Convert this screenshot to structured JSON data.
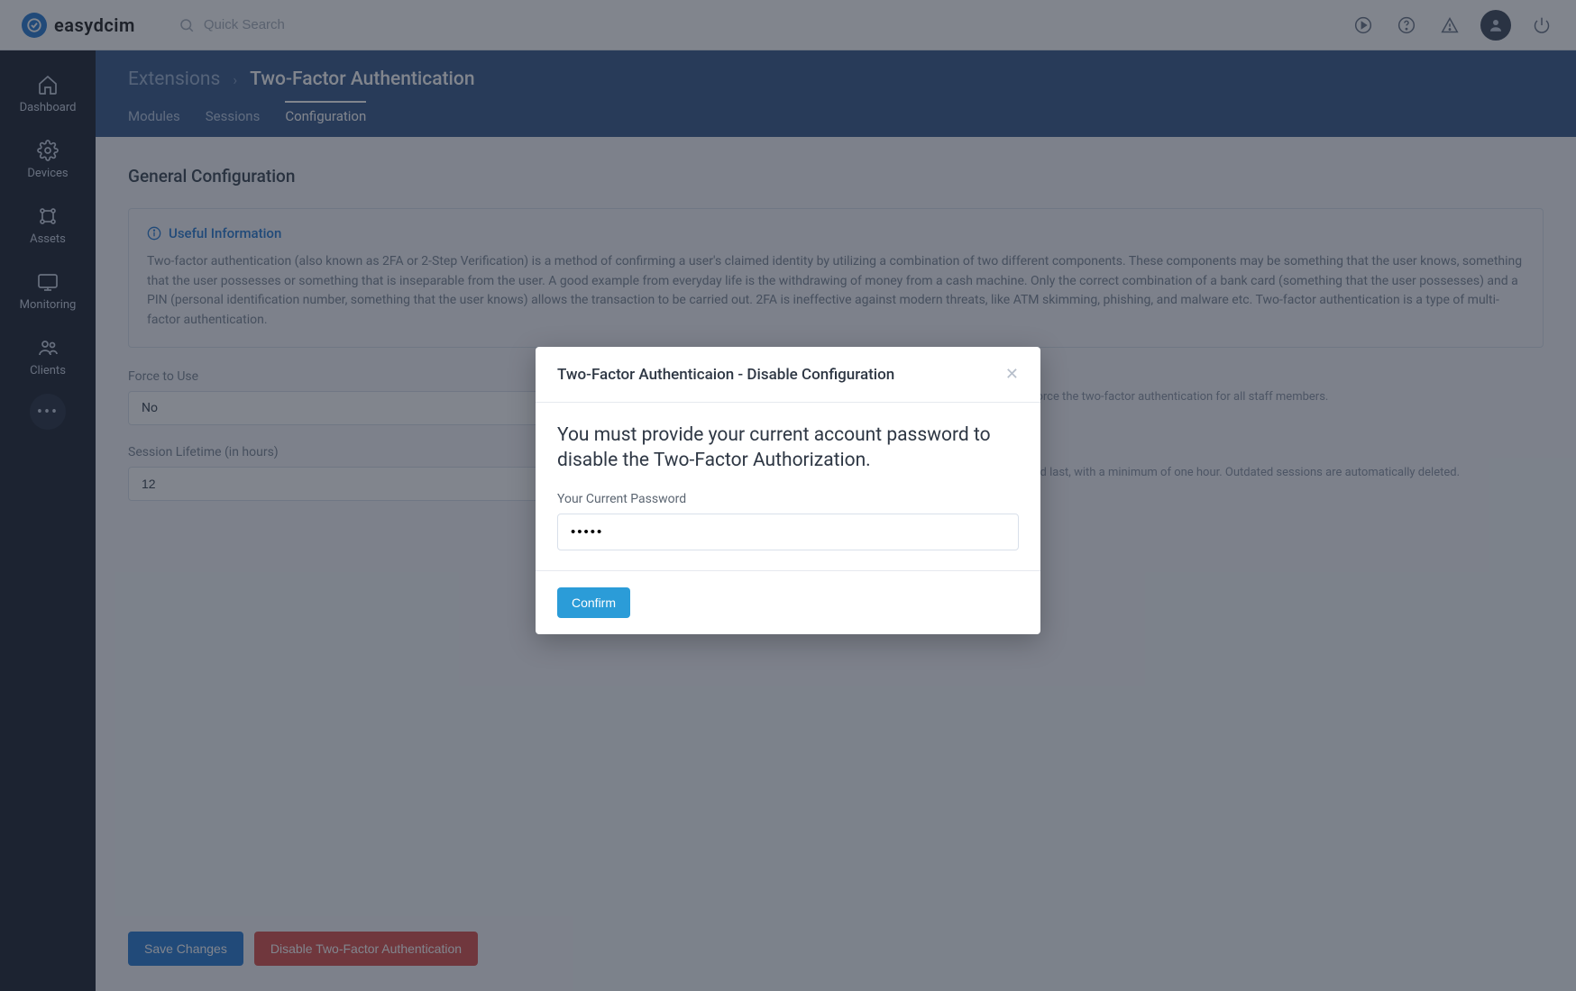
{
  "brand": {
    "name": "easydcim"
  },
  "search": {
    "placeholder": "Quick Search"
  },
  "sidebar": {
    "items": [
      {
        "label": "Dashboard"
      },
      {
        "label": "Devices"
      },
      {
        "label": "Assets"
      },
      {
        "label": "Monitoring"
      },
      {
        "label": "Clients"
      }
    ]
  },
  "breadcrumb": {
    "parent": "Extensions",
    "current": "Two-Factor Authentication"
  },
  "tabs": [
    {
      "label": "Modules",
      "active": false
    },
    {
      "label": "Sessions",
      "active": false
    },
    {
      "label": "Configuration",
      "active": true
    }
  ],
  "section": {
    "title": "General Configuration",
    "info_title": "Useful Information",
    "info_body": "Two-factor authentication (also known as 2FA or 2-Step Verification) is a method of confirming a user's claimed identity by utilizing a combination of two different components. These components may be something that the user knows, something that the user possesses or something that is inseparable from the user. A good example from everyday life is the withdrawing of money from a cash machine. Only the correct combination of a bank card (something that the user possesses) and a PIN (personal identification number, something that the user knows) allows the transaction to be carried out. 2FA is ineffective against modern threats, like ATM skimming, phishing, and malware etc. Two-factor authentication is a type of multi-factor authentication."
  },
  "form": {
    "force_label": "Force to Use",
    "force_value": "No",
    "force_help": "By selecting this option you will enforce the two-factor authentication for all staff members.",
    "session_label": "Session Lifetime (in hours)",
    "session_value": "12",
    "session_help": "Define how long each session should last, with a minimum of one hour. Outdated sessions are automatically deleted."
  },
  "actions": {
    "save": "Save Changes",
    "disable": "Disable Two-Factor Authentication"
  },
  "modal": {
    "title": "Two-Factor Authenticaion - Disable Configuration",
    "message": "You must provide your current account password to disable the Two-Factor Authorization.",
    "password_label": "Your Current Password",
    "password_value": "•••••",
    "confirm": "Confirm"
  }
}
